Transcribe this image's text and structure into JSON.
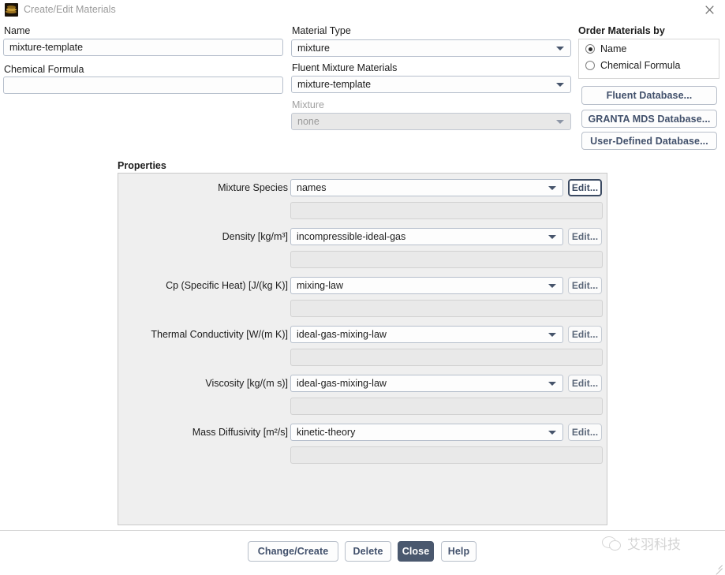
{
  "window": {
    "title": "Create/Edit Materials",
    "icon": "fluent-layers-icon",
    "close_icon": "close-icon"
  },
  "left_form": {
    "name_label": "Name",
    "name_value": "mixture-template",
    "chemical_formula_label": "Chemical Formula",
    "chemical_formula_value": ""
  },
  "middle_form": {
    "material_type_label": "Material Type",
    "material_type_value": "mixture",
    "fluent_mixture_materials_label": "Fluent Mixture Materials",
    "fluent_mixture_materials_value": "mixture-template",
    "mixture_label": "Mixture",
    "mixture_value": "none"
  },
  "order_materials": {
    "group_label": "Order Materials by",
    "options": [
      {
        "label": "Name",
        "selected": true
      },
      {
        "label": "Chemical Formula",
        "selected": false
      }
    ],
    "buttons": [
      {
        "label": "Fluent Database..."
      },
      {
        "label": "GRANTA MDS Database..."
      },
      {
        "label": "User-Defined Database..."
      }
    ]
  },
  "properties": {
    "section_label": "Properties",
    "edit_label": "Edit...",
    "rows": [
      {
        "label": "Mixture Species",
        "value": "names",
        "sub_value": ""
      },
      {
        "label": "Density [kg/m³]",
        "value": "incompressible-ideal-gas",
        "sub_value": ""
      },
      {
        "label": "Cp (Specific Heat) [J/(kg K)]",
        "value": "mixing-law",
        "sub_value": ""
      },
      {
        "label": "Thermal Conductivity [W/(m K)]",
        "value": "ideal-gas-mixing-law",
        "sub_value": ""
      },
      {
        "label": "Viscosity [kg/(m s)]",
        "value": "ideal-gas-mixing-law",
        "sub_value": ""
      },
      {
        "label": "Mass Diffusivity [m²/s]",
        "value": "kinetic-theory",
        "sub_value": ""
      }
    ]
  },
  "footer": {
    "buttons": [
      {
        "label": "Change/Create",
        "primary": false
      },
      {
        "label": "Delete",
        "primary": false
      },
      {
        "label": "Close",
        "primary": true
      },
      {
        "label": "Help",
        "primary": false
      }
    ]
  },
  "watermark": {
    "text": "艾羽科技",
    "logo": "wechat-icon"
  },
  "colors": {
    "accent": "#4a586e",
    "panel_bg": "#efefef",
    "field_border": "#b6bfcc",
    "button_text": "#41506b"
  }
}
